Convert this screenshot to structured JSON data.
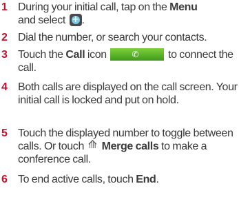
{
  "steps": [
    {
      "number": "1",
      "parts": [
        "During your initial call, tap on the ",
        "Menu",
        " and select ",
        "."
      ],
      "icon": "add-call-icon"
    },
    {
      "number": "2",
      "text": "Dial the number, or search your contacts."
    },
    {
      "number": "3",
      "parts": [
        "Touch the ",
        "Call",
        " icon ",
        " to connect the call."
      ],
      "icon": "phone-icon"
    },
    {
      "number": "4",
      "text": "Both calls are displayed on the call screen. Your initial call is locked and put on hold."
    },
    {
      "number": "5",
      "parts": [
        "Touch the displayed number to toggle between calls. Or touch ",
        "Merge calls",
        " to make a conference call."
      ],
      "icon": "merge-calls-icon"
    },
    {
      "number": "6",
      "parts": [
        "To end active calls, touch ",
        "End",
        "."
      ]
    }
  ],
  "colors": {
    "step_number": "#c8102e",
    "body_text": "#3a3a3a",
    "call_button": "#5cb82a"
  }
}
